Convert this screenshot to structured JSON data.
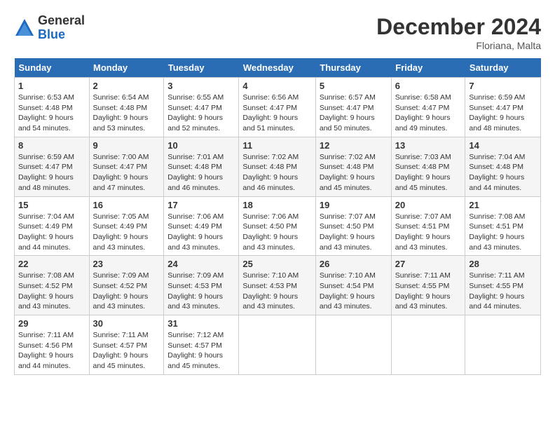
{
  "logo": {
    "general": "General",
    "blue": "Blue"
  },
  "title": {
    "month": "December 2024",
    "location": "Floriana, Malta"
  },
  "headers": [
    "Sunday",
    "Monday",
    "Tuesday",
    "Wednesday",
    "Thursday",
    "Friday",
    "Saturday"
  ],
  "weeks": [
    [
      {
        "day": "1",
        "sunrise": "Sunrise: 6:53 AM",
        "sunset": "Sunset: 4:48 PM",
        "daylight": "Daylight: 9 hours and 54 minutes."
      },
      {
        "day": "2",
        "sunrise": "Sunrise: 6:54 AM",
        "sunset": "Sunset: 4:48 PM",
        "daylight": "Daylight: 9 hours and 53 minutes."
      },
      {
        "day": "3",
        "sunrise": "Sunrise: 6:55 AM",
        "sunset": "Sunset: 4:47 PM",
        "daylight": "Daylight: 9 hours and 52 minutes."
      },
      {
        "day": "4",
        "sunrise": "Sunrise: 6:56 AM",
        "sunset": "Sunset: 4:47 PM",
        "daylight": "Daylight: 9 hours and 51 minutes."
      },
      {
        "day": "5",
        "sunrise": "Sunrise: 6:57 AM",
        "sunset": "Sunset: 4:47 PM",
        "daylight": "Daylight: 9 hours and 50 minutes."
      },
      {
        "day": "6",
        "sunrise": "Sunrise: 6:58 AM",
        "sunset": "Sunset: 4:47 PM",
        "daylight": "Daylight: 9 hours and 49 minutes."
      },
      {
        "day": "7",
        "sunrise": "Sunrise: 6:59 AM",
        "sunset": "Sunset: 4:47 PM",
        "daylight": "Daylight: 9 hours and 48 minutes."
      }
    ],
    [
      {
        "day": "8",
        "sunrise": "Sunrise: 6:59 AM",
        "sunset": "Sunset: 4:47 PM",
        "daylight": "Daylight: 9 hours and 48 minutes."
      },
      {
        "day": "9",
        "sunrise": "Sunrise: 7:00 AM",
        "sunset": "Sunset: 4:47 PM",
        "daylight": "Daylight: 9 hours and 47 minutes."
      },
      {
        "day": "10",
        "sunrise": "Sunrise: 7:01 AM",
        "sunset": "Sunset: 4:48 PM",
        "daylight": "Daylight: 9 hours and 46 minutes."
      },
      {
        "day": "11",
        "sunrise": "Sunrise: 7:02 AM",
        "sunset": "Sunset: 4:48 PM",
        "daylight": "Daylight: 9 hours and 46 minutes."
      },
      {
        "day": "12",
        "sunrise": "Sunrise: 7:02 AM",
        "sunset": "Sunset: 4:48 PM",
        "daylight": "Daylight: 9 hours and 45 minutes."
      },
      {
        "day": "13",
        "sunrise": "Sunrise: 7:03 AM",
        "sunset": "Sunset: 4:48 PM",
        "daylight": "Daylight: 9 hours and 45 minutes."
      },
      {
        "day": "14",
        "sunrise": "Sunrise: 7:04 AM",
        "sunset": "Sunset: 4:48 PM",
        "daylight": "Daylight: 9 hours and 44 minutes."
      }
    ],
    [
      {
        "day": "15",
        "sunrise": "Sunrise: 7:04 AM",
        "sunset": "Sunset: 4:49 PM",
        "daylight": "Daylight: 9 hours and 44 minutes."
      },
      {
        "day": "16",
        "sunrise": "Sunrise: 7:05 AM",
        "sunset": "Sunset: 4:49 PM",
        "daylight": "Daylight: 9 hours and 43 minutes."
      },
      {
        "day": "17",
        "sunrise": "Sunrise: 7:06 AM",
        "sunset": "Sunset: 4:49 PM",
        "daylight": "Daylight: 9 hours and 43 minutes."
      },
      {
        "day": "18",
        "sunrise": "Sunrise: 7:06 AM",
        "sunset": "Sunset: 4:50 PM",
        "daylight": "Daylight: 9 hours and 43 minutes."
      },
      {
        "day": "19",
        "sunrise": "Sunrise: 7:07 AM",
        "sunset": "Sunset: 4:50 PM",
        "daylight": "Daylight: 9 hours and 43 minutes."
      },
      {
        "day": "20",
        "sunrise": "Sunrise: 7:07 AM",
        "sunset": "Sunset: 4:51 PM",
        "daylight": "Daylight: 9 hours and 43 minutes."
      },
      {
        "day": "21",
        "sunrise": "Sunrise: 7:08 AM",
        "sunset": "Sunset: 4:51 PM",
        "daylight": "Daylight: 9 hours and 43 minutes."
      }
    ],
    [
      {
        "day": "22",
        "sunrise": "Sunrise: 7:08 AM",
        "sunset": "Sunset: 4:52 PM",
        "daylight": "Daylight: 9 hours and 43 minutes."
      },
      {
        "day": "23",
        "sunrise": "Sunrise: 7:09 AM",
        "sunset": "Sunset: 4:52 PM",
        "daylight": "Daylight: 9 hours and 43 minutes."
      },
      {
        "day": "24",
        "sunrise": "Sunrise: 7:09 AM",
        "sunset": "Sunset: 4:53 PM",
        "daylight": "Daylight: 9 hours and 43 minutes."
      },
      {
        "day": "25",
        "sunrise": "Sunrise: 7:10 AM",
        "sunset": "Sunset: 4:53 PM",
        "daylight": "Daylight: 9 hours and 43 minutes."
      },
      {
        "day": "26",
        "sunrise": "Sunrise: 7:10 AM",
        "sunset": "Sunset: 4:54 PM",
        "daylight": "Daylight: 9 hours and 43 minutes."
      },
      {
        "day": "27",
        "sunrise": "Sunrise: 7:11 AM",
        "sunset": "Sunset: 4:55 PM",
        "daylight": "Daylight: 9 hours and 43 minutes."
      },
      {
        "day": "28",
        "sunrise": "Sunrise: 7:11 AM",
        "sunset": "Sunset: 4:55 PM",
        "daylight": "Daylight: 9 hours and 44 minutes."
      }
    ],
    [
      {
        "day": "29",
        "sunrise": "Sunrise: 7:11 AM",
        "sunset": "Sunset: 4:56 PM",
        "daylight": "Daylight: 9 hours and 44 minutes."
      },
      {
        "day": "30",
        "sunrise": "Sunrise: 7:11 AM",
        "sunset": "Sunset: 4:57 PM",
        "daylight": "Daylight: 9 hours and 45 minutes."
      },
      {
        "day": "31",
        "sunrise": "Sunrise: 7:12 AM",
        "sunset": "Sunset: 4:57 PM",
        "daylight": "Daylight: 9 hours and 45 minutes."
      },
      null,
      null,
      null,
      null
    ]
  ]
}
